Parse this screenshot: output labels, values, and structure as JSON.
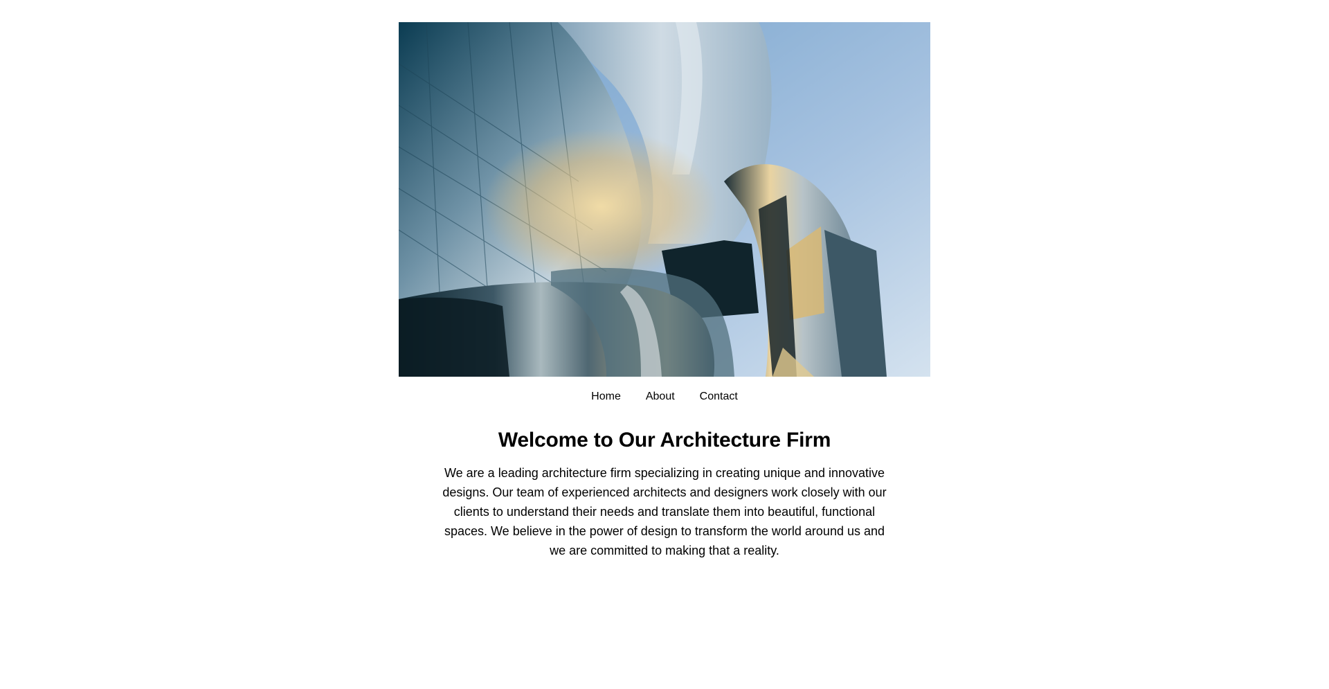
{
  "hero": {
    "image_subject": "building-photo"
  },
  "nav": {
    "items": [
      {
        "label": "Home"
      },
      {
        "label": "About"
      },
      {
        "label": "Contact"
      }
    ]
  },
  "main": {
    "title": "Welcome to Our Architecture Firm",
    "intro": "We are a leading architecture firm specializing in creating unique and innovative designs. Our team of experienced architects and designers work closely with our clients to understand their needs and translate them into beautiful, functional spaces. We believe in the power of design to transform the world around us and we are committed to making that a reality."
  },
  "colors": {
    "background": "#ffffff",
    "text": "#000000",
    "sky": "#86acd3",
    "steel_dark": "#0d3a4e",
    "steel_light": "#b9cfdf",
    "sun_glow": "#e7c98e"
  }
}
